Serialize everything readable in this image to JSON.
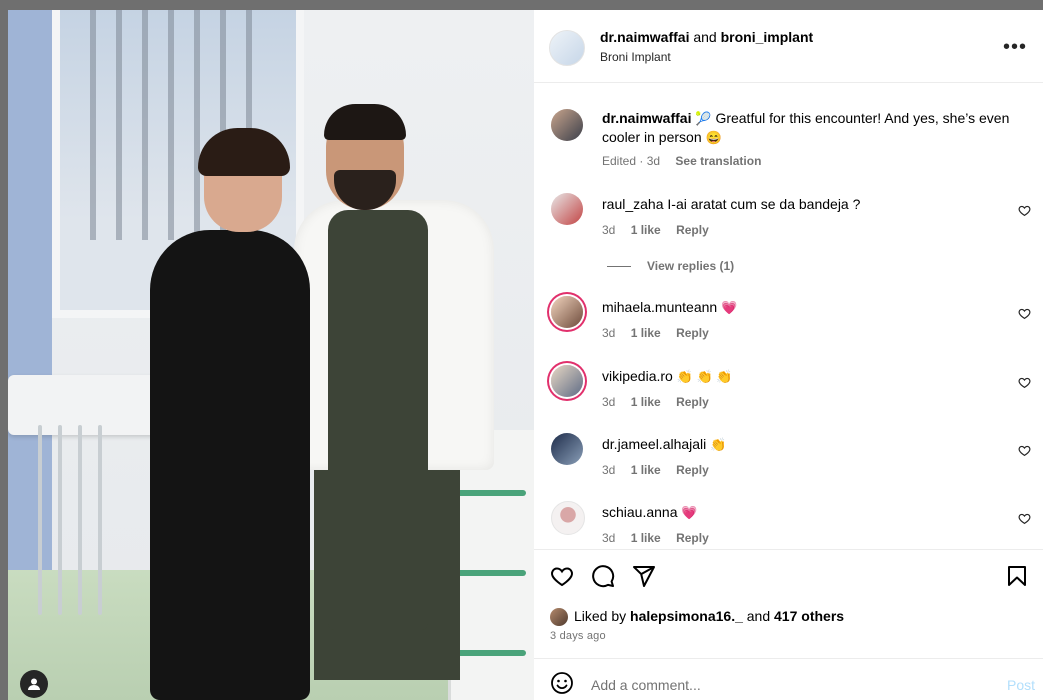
{
  "post": {
    "author": "dr.naimwaffai",
    "connector": "and",
    "coauthor": "broni_implant",
    "location": "Broni Implant"
  },
  "caption": {
    "username": "dr.naimwaffai",
    "emoji_lead": "🎾",
    "text": "Greatful for this encounter! And yes, she’s even cooler in person",
    "emoji_tail": "😄",
    "edited": "Edited · 3d",
    "see_translation": "See translation"
  },
  "comments": [
    {
      "username": "raul_zaha",
      "text": "I-ai aratat cum se da bandeja ?",
      "time": "3d",
      "likes": "1 like",
      "reply": "Reply"
    },
    {
      "username": "mihaela.munteann",
      "text": "💗",
      "time": "3d",
      "likes": "1 like",
      "reply": "Reply"
    },
    {
      "username": "vikipedia.ro",
      "text": "👏 👏 👏",
      "time": "3d",
      "likes": "1 like",
      "reply": "Reply"
    },
    {
      "username": "dr.jameel.alhajali",
      "text": "👏",
      "time": "3d",
      "likes": "1 like",
      "reply": "Reply"
    },
    {
      "username": "schiau.anna",
      "text": "💗",
      "time": "3d",
      "likes": "1 like",
      "reply": "Reply"
    }
  ],
  "view_replies": "View replies (1)",
  "likes": {
    "prefix": "Liked by",
    "user": "halepsimona16._",
    "conj": "and",
    "others": "417 others"
  },
  "date": "3 days ago",
  "add_comment": {
    "placeholder": "Add a comment...",
    "post": "Post"
  },
  "icons": [
    "more-icon",
    "heart-icon",
    "comment-icon",
    "share-icon",
    "bookmark-icon",
    "emoji-icon",
    "user-icon"
  ]
}
